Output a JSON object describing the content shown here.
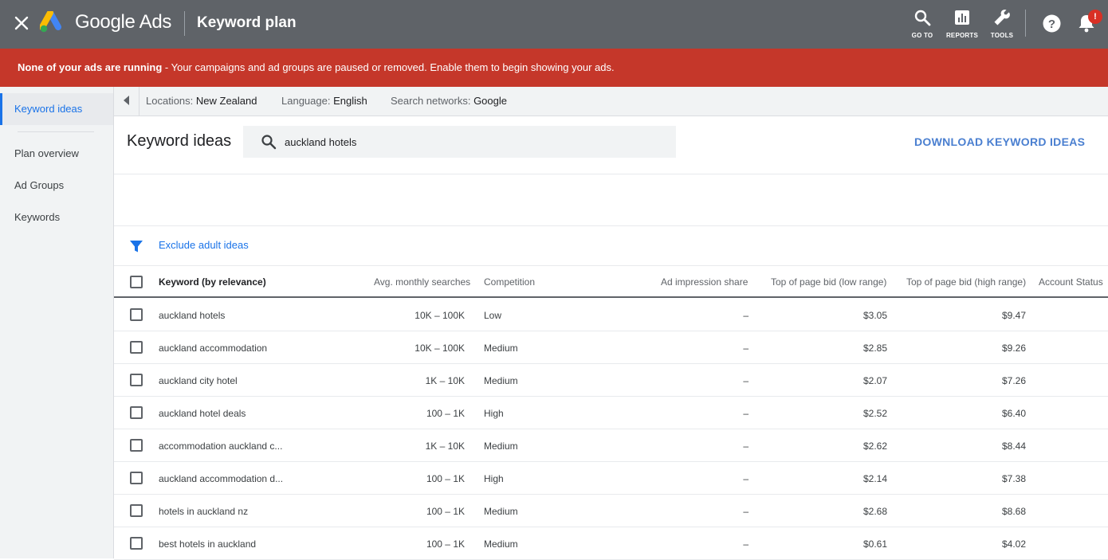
{
  "header": {
    "brand": "Google Ads",
    "page_title": "Keyword plan",
    "tools": [
      {
        "label": "GO TO",
        "icon": "search-icon"
      },
      {
        "label": "REPORTS",
        "icon": "reports-icon"
      },
      {
        "label": "TOOLS",
        "icon": "wrench-icon"
      }
    ],
    "notification_badge": "!"
  },
  "alert": {
    "bold": "None of your ads are running",
    "text": " - Your campaigns and ad groups are paused or removed. Enable them to begin showing your ads."
  },
  "sidebar": {
    "items": [
      {
        "label": "Keyword ideas",
        "active": true
      },
      {
        "label": "Plan overview"
      },
      {
        "label": "Ad Groups"
      },
      {
        "label": "Keywords"
      }
    ]
  },
  "filters": {
    "location_label": "Locations:",
    "location_value": "New Zealand",
    "language_label": "Language:",
    "language_value": "English",
    "network_label": "Search networks:",
    "network_value": "Google"
  },
  "main": {
    "heading": "Keyword ideas",
    "search_value": "auckland hotels",
    "download_label": "DOWNLOAD KEYWORD IDEAS",
    "exclude_label": "Exclude adult ideas"
  },
  "table": {
    "columns": {
      "keyword": "Keyword (by relevance)",
      "searches": "Avg. monthly searches",
      "competition": "Competition",
      "impression": "Ad impression share",
      "low_bid": "Top of page bid (low range)",
      "high_bid": "Top of page bid (high range)",
      "status": "Account Status"
    },
    "rows": [
      {
        "keyword": "auckland hotels",
        "searches": "10K – 100K",
        "competition": "Low",
        "impression": "–",
        "low_bid": "$3.05",
        "high_bid": "$9.47"
      },
      {
        "keyword": "auckland accommodation",
        "searches": "10K – 100K",
        "competition": "Medium",
        "impression": "–",
        "low_bid": "$2.85",
        "high_bid": "$9.26"
      },
      {
        "keyword": "auckland city hotel",
        "searches": "1K – 10K",
        "competition": "Medium",
        "impression": "–",
        "low_bid": "$2.07",
        "high_bid": "$7.26"
      },
      {
        "keyword": "auckland hotel deals",
        "searches": "100 – 1K",
        "competition": "High",
        "impression": "–",
        "low_bid": "$2.52",
        "high_bid": "$6.40"
      },
      {
        "keyword": "accommodation auckland c...",
        "searches": "1K – 10K",
        "competition": "Medium",
        "impression": "–",
        "low_bid": "$2.62",
        "high_bid": "$8.44"
      },
      {
        "keyword": "auckland accommodation d...",
        "searches": "100 – 1K",
        "competition": "High",
        "impression": "–",
        "low_bid": "$2.14",
        "high_bid": "$7.38"
      },
      {
        "keyword": "hotels in auckland nz",
        "searches": "100 – 1K",
        "competition": "Medium",
        "impression": "–",
        "low_bid": "$2.68",
        "high_bid": "$8.68"
      },
      {
        "keyword": "best hotels in auckland",
        "searches": "100 – 1K",
        "competition": "Medium",
        "impression": "–",
        "low_bid": "$0.61",
        "high_bid": "$4.02"
      }
    ]
  },
  "colors": {
    "header_bg": "#5f6368",
    "alert_bg": "#c5372a",
    "accent": "#1a73e8"
  }
}
